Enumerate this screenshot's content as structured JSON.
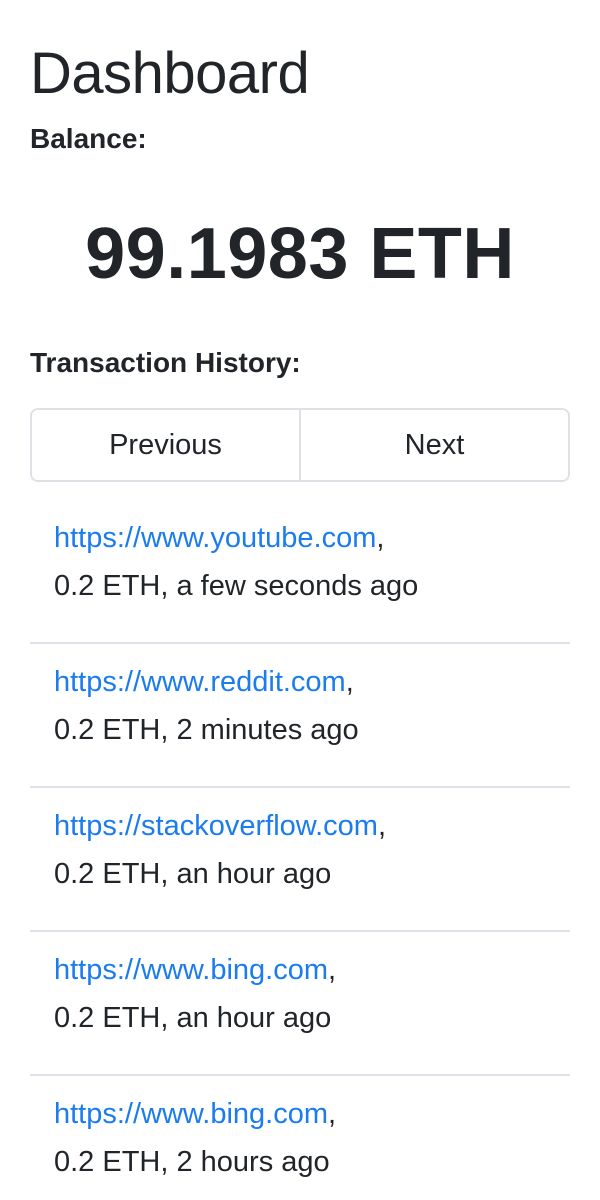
{
  "header": {
    "title": "Dashboard"
  },
  "balance": {
    "label": "Balance:",
    "value": "99.1983 ETH"
  },
  "history": {
    "label": "Transaction History:",
    "pager": {
      "previous_label": "Previous",
      "next_label": "Next"
    },
    "transactions": [
      {
        "url": "https://www.youtube.com",
        "comma": ",",
        "details": "0.2 ETH, a few seconds ago"
      },
      {
        "url": "https://www.reddit.com",
        "comma": ",",
        "details": "0.2 ETH, 2 minutes ago"
      },
      {
        "url": "https://stackoverflow.com",
        "comma": ",",
        "details": "0.2 ETH, an hour ago"
      },
      {
        "url": "https://www.bing.com",
        "comma": ",",
        "details": "0.2 ETH, an hour ago"
      },
      {
        "url": "https://www.bing.com",
        "comma": ",",
        "details": "0.2 ETH, 2 hours ago"
      }
    ]
  },
  "colors": {
    "link": "#1a7cef",
    "text": "#212529",
    "border": "#dee2e6"
  }
}
